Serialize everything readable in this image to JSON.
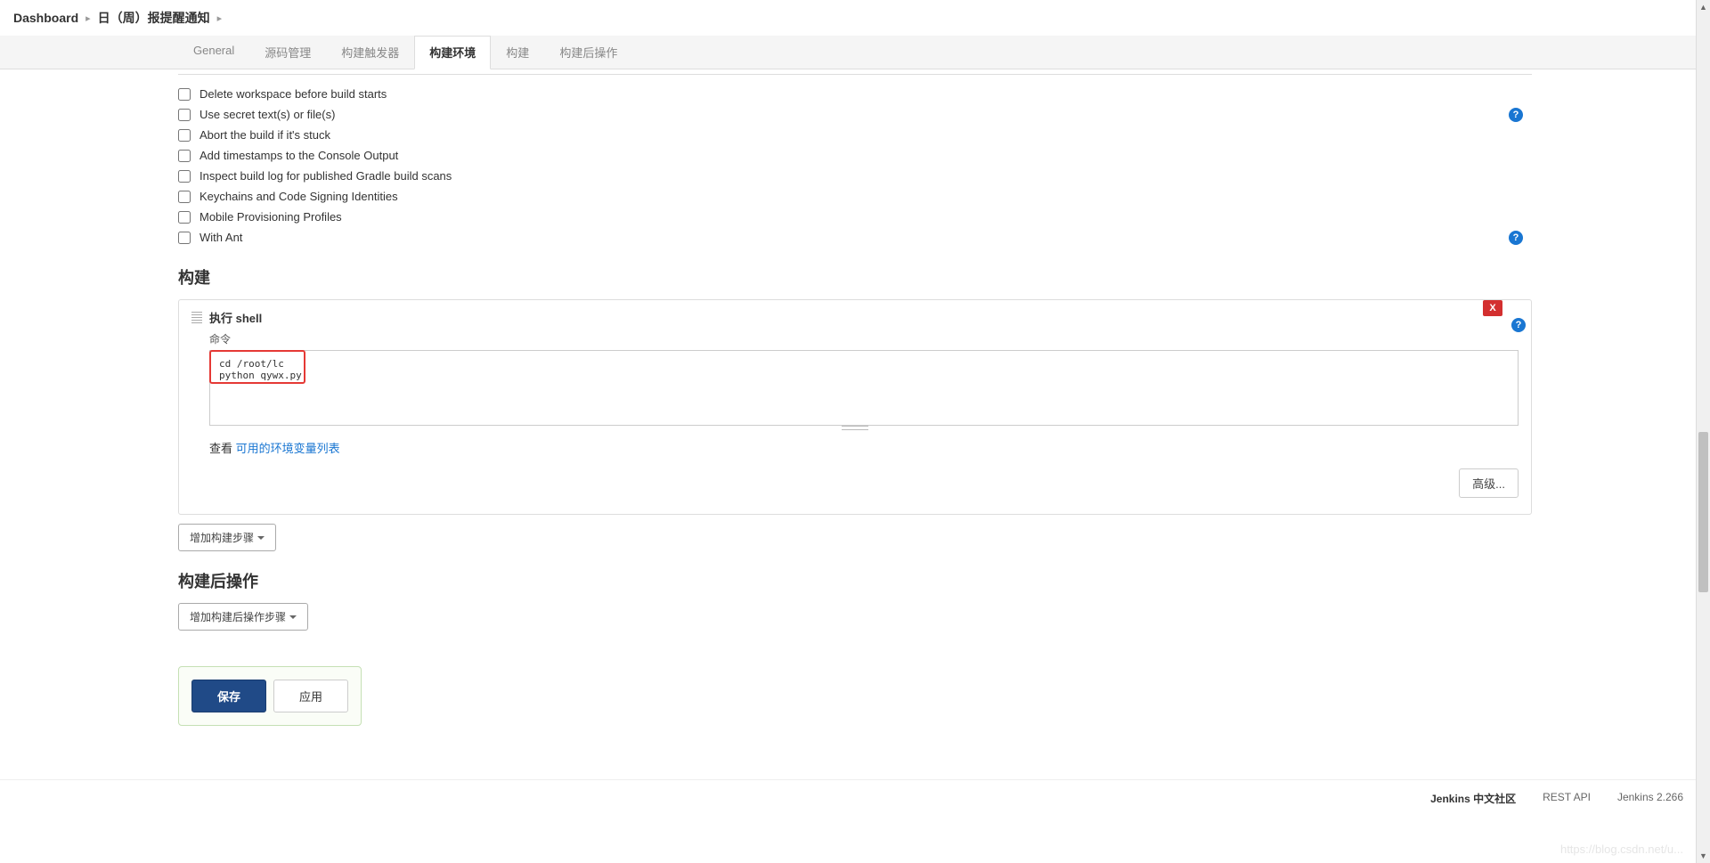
{
  "breadcrumb": {
    "dashboard": "Dashboard",
    "job": "日（周）报提醒通知"
  },
  "tabs": {
    "general": "General",
    "scm": "源码管理",
    "triggers": "构建触发器",
    "env": "构建环境",
    "build": "构建",
    "post": "构建后操作"
  },
  "env_options": {
    "delete_ws": "Delete workspace before build starts",
    "secret_text": "Use secret text(s) or file(s)",
    "abort_stuck": "Abort the build if it's stuck",
    "timestamps": "Add timestamps to the Console Output",
    "gradle_scans": "Inspect build log for published Gradle build scans",
    "keychains": "Keychains and Code Signing Identities",
    "mobile_prov": "Mobile Provisioning Profiles",
    "with_ant": "With Ant"
  },
  "build_section": {
    "title": "构建",
    "step_title": "执行 shell",
    "command_label": "命令",
    "command_value": "cd /root/lc\npython qywx.py",
    "note_prefix": "查看 ",
    "note_link": "可用的环境变量列表",
    "advanced_btn": "高级...",
    "add_step_btn": "增加构建步骤",
    "delete_label": "X"
  },
  "post_section": {
    "title": "构建后操作",
    "add_btn": "增加构建后操作步骤"
  },
  "footer_btns": {
    "save": "保存",
    "apply": "应用"
  },
  "page_footer": {
    "community": "Jenkins 中文社区",
    "rest_api": "REST API",
    "version": "Jenkins 2.266"
  },
  "help_glyph": "?"
}
